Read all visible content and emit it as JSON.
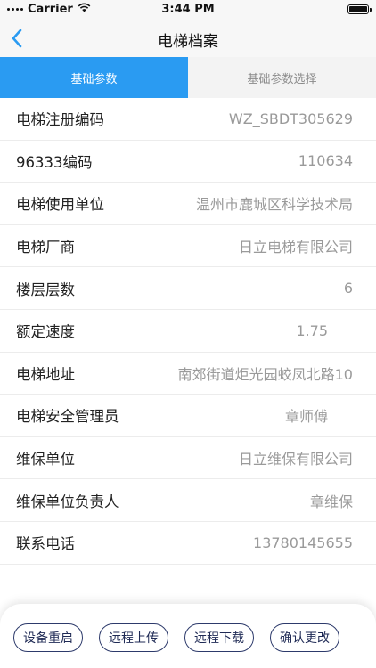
{
  "status_bar": {
    "carrier": "Carrier",
    "time": "3:44 PM"
  },
  "nav": {
    "title": "电梯档案"
  },
  "tabs": [
    {
      "label": "基础参数",
      "active": true
    },
    {
      "label": "基础参数选择",
      "active": false
    }
  ],
  "fields": [
    {
      "label": "电梯注册编码",
      "value": "WZ_SBDT305629"
    },
    {
      "label": "96333编码",
      "value": "110634"
    },
    {
      "label": "电梯使用单位",
      "value": "温州市鹿城区科学技术局"
    },
    {
      "label": "电梯厂商",
      "value": "日立电梯有限公司"
    },
    {
      "label": "楼层层数",
      "value": "6"
    },
    {
      "label": "额定速度",
      "value": "1.75"
    },
    {
      "label": "电梯地址",
      "value": "南郊街道炬光园蛟凤北路10"
    },
    {
      "label": "电梯安全管理员",
      "value": "章师傅"
    },
    {
      "label": "维保单位",
      "value": "日立维保有限公司"
    },
    {
      "label": "维保单位负责人",
      "value": "章维保"
    },
    {
      "label": "联系电话",
      "value": "13780145655"
    }
  ],
  "actions": [
    {
      "label": "设备重启"
    },
    {
      "label": "远程上传"
    },
    {
      "label": "远程下载"
    },
    {
      "label": "确认更改"
    }
  ],
  "colors": {
    "accent": "#2a9bf2",
    "button_border": "#2d3a6b"
  }
}
